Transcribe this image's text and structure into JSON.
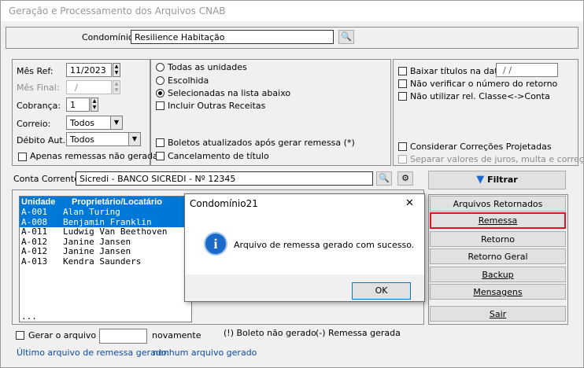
{
  "window": {
    "title": "Geração e Processamento dos Arquivos CNAB"
  },
  "condominio": {
    "label": "Condomínio:",
    "value": "Resilience Habitação"
  },
  "left_panel": {
    "mes_ref_label": "Mês Ref:",
    "mes_ref_value": "11/2023",
    "mes_final_label": "Mês Final:",
    "mes_final_value": "/",
    "cobranca_label": "Cobrança:",
    "cobranca_value": "1",
    "correio_label": "Correio:",
    "correio_value": "Todos",
    "debito_label": "Débito Aut.:",
    "debito_value": "Todos",
    "apenas_label": "Apenas remessas não geradas"
  },
  "middle_panel": {
    "todas_label": "Todas as unidades",
    "escolhida_label": "Escolhida",
    "selecionadas_label": "Selecionadas na lista abaixo",
    "incluir_label": "Incluir Outras Receitas",
    "boletos_label": "Boletos atualizados após gerar remessa (*)",
    "cancelamento_label": "Cancelamento de título",
    "selected_radio": "selecionadas"
  },
  "right_panel": {
    "baixar_label": "Baixar títulos na data:",
    "baixar_value": "/ /",
    "nao_verificar_label": "Não verificar o número do retorno",
    "nao_utilizar_label": "Não utilizar rel. Classe<->Conta",
    "considerar_label": "Considerar Correções Projetadas",
    "separar_label": "Separar valores de juros, multa e correção"
  },
  "conta": {
    "label": "Conta Corrente:",
    "value": "Sicredi - BANCO SICREDI - Nº 12345"
  },
  "filtrar": {
    "label": "Filtrar"
  },
  "list": {
    "headers": [
      "Unidade",
      "Proprietário/Locatário"
    ],
    "rows": [
      {
        "unidade": "A-001",
        "nome": "Alan Turing"
      },
      {
        "unidade": "A-008",
        "nome": "Benjamin Franklin"
      },
      {
        "unidade": "A-011",
        "nome": "Ludwig Van Beethoven"
      },
      {
        "unidade": "A-012",
        "nome": "Janine Jansen"
      },
      {
        "unidade": "A-012",
        "nome": "Janine Jansen"
      },
      {
        "unidade": "A-013",
        "nome": "Kendra Saunders"
      }
    ],
    "more": "..."
  },
  "actions": {
    "arquivos_retornados": "Arquivos Retornados",
    "remessa": "Remessa",
    "retorno": "Retorno",
    "retorno_geral": "Retorno Geral",
    "backup": "Backup",
    "mensagens": "Mensagens",
    "sair": "Sair"
  },
  "footer": {
    "gerar_label": "Gerar o arquivo",
    "novamente_label": "novamente",
    "legend_boleto": "(!) Boleto não gerado",
    "legend_remessa": "(-) Remessa gerada",
    "ultimo_label": "Último arquivo de remessa gerado:",
    "ultimo_value": "nenhum arquivo gerado"
  },
  "dialog": {
    "title": "Condomínio21",
    "close": "✕",
    "message": "Arquivo de remessa gerado com sucesso.",
    "ok": "OK"
  },
  "colors": {
    "selection": "#0078d7",
    "highlight_border": "#e81123",
    "info_icon": "#1b6ac9"
  }
}
